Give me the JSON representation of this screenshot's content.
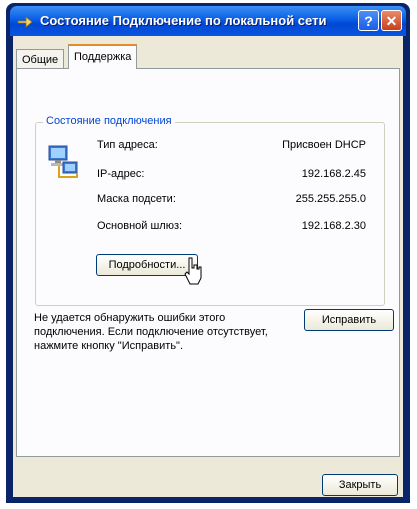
{
  "window": {
    "title": "Состояние Подключение по локальной сети",
    "help_label": "?",
    "close_label": "✕"
  },
  "tabs": [
    {
      "label": "Общие",
      "active": false
    },
    {
      "label": "Поддержка",
      "active": true
    }
  ],
  "status_group": {
    "label": "Состояние подключения",
    "rows": [
      {
        "label": "Тип адреса:",
        "value": "Присвоен DHCP"
      },
      {
        "label": "IP-адрес:",
        "value": "192.168.2.45"
      },
      {
        "label": "Маска подсети:",
        "value": "255.255.255.0"
      },
      {
        "label": "Основной шлюз:",
        "value": "192.168.2.30"
      }
    ],
    "details_button": "Подробности..."
  },
  "diagnose": {
    "message": "Не удается обнаружить ошибки этого подключения. Если подключение отсутствует, нажмите кнопку \"Исправить\".",
    "fix_button": "Исправить"
  },
  "footer": {
    "close_button": "Закрыть"
  },
  "icons": {
    "title": "network-connection-icon",
    "status": "network-computer-icon",
    "pointer": "mouse-cursor-icon"
  },
  "colors": {
    "titlebar": "#0a5ee6",
    "group_label": "#0046d5",
    "active_tab_accent": "#e68b2c",
    "dialog_bg": "#ece9d8"
  }
}
